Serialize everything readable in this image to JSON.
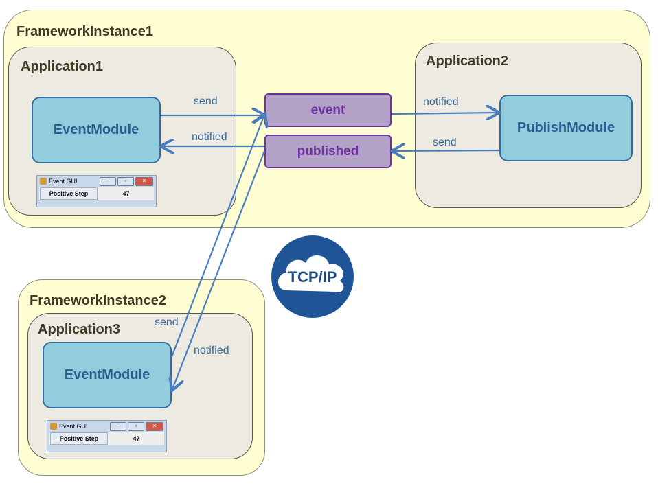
{
  "framework1": {
    "title": "FrameworkInstance1"
  },
  "framework2": {
    "title": "FrameworkInstance2"
  },
  "app1": {
    "title": "Application1",
    "module": "EventModule"
  },
  "app2": {
    "title": "Application2",
    "module": "PublishModule"
  },
  "app3": {
    "title": "Application3",
    "module": "EventModule"
  },
  "topics": {
    "event": "event",
    "published": "published"
  },
  "labels": {
    "a1_send": "send",
    "a1_notified": "notified",
    "a2_notified": "notified",
    "a2_send": "send",
    "a3_send": "send",
    "a3_notified": "notified"
  },
  "gui1": {
    "title": "Event GUI",
    "button": "Positive Step",
    "value": "47"
  },
  "gui2": {
    "title": "Event GUI",
    "button": "Positive Step",
    "value": "47"
  },
  "tcp": {
    "text": "TCP/IP"
  },
  "colors": {
    "module": "#92cddd",
    "topic": "#b3a2c7",
    "topic_border": "#7030a0",
    "arrow": "#4a7cc0",
    "tcp": "#1f5596"
  }
}
